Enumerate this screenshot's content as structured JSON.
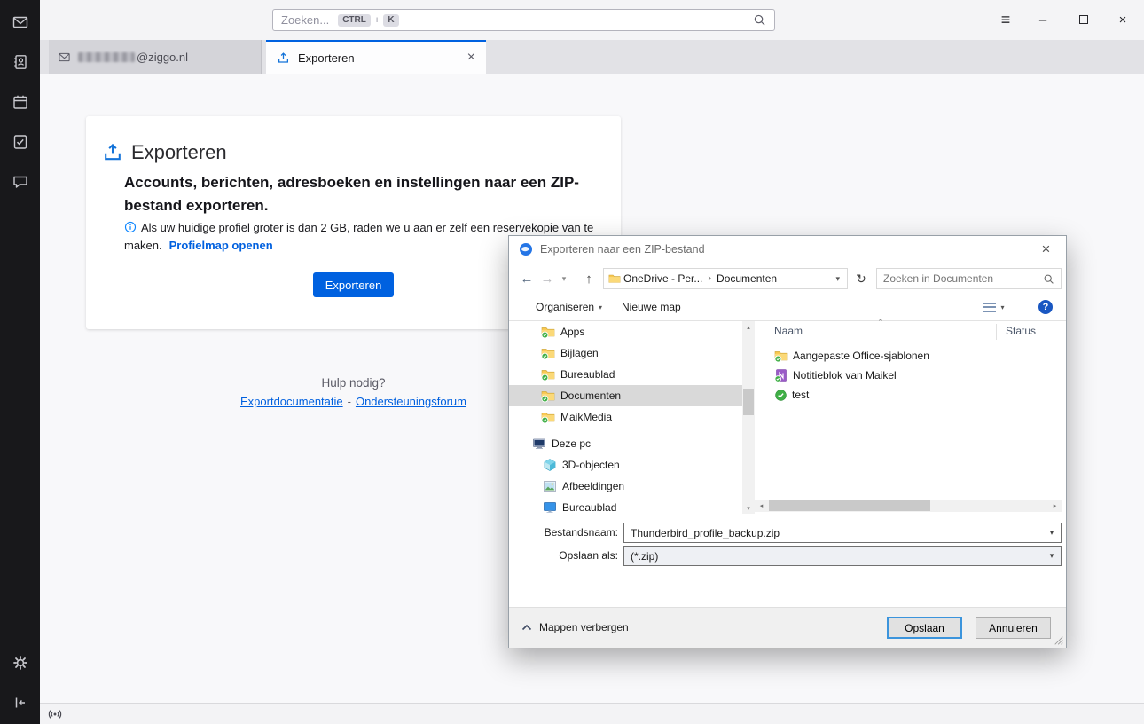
{
  "colors": {
    "accent_blue": "#0061e0",
    "link_blue": "#0060df",
    "selection_gray": "#d9d9d9",
    "sync_green": "#3faf46",
    "default_button_border": "#0078d7"
  },
  "topbar": {
    "search_placeholder": "Zoeken...",
    "shortcut_ctrl": "CTRL",
    "shortcut_plus": "+",
    "shortcut_k": "K"
  },
  "tabs": {
    "account_suffix": "@ziggo.nl",
    "export_label": "Exporteren"
  },
  "export_page": {
    "title": "Exporteren",
    "subtitle": "Accounts, berichten, adresboeken en instellingen naar een ZIP-bestand exporteren.",
    "info_text": "Als uw huidige profiel groter is dan 2 GB, raden we u aan er zelf een reservekopie van te maken.",
    "profile_link": "Profielmap openen",
    "export_button": "Exporteren",
    "help_heading": "Hulp nodig?",
    "help_link_docs": "Exportdocumentatie",
    "help_separator": "-",
    "help_link_forum": "Ondersteuningsforum"
  },
  "dialog": {
    "title": "Exporteren naar een ZIP-bestand",
    "breadcrumb_root": "OneDrive - Per...",
    "breadcrumb_current": "Documenten",
    "search_placeholder": "Zoeken in Documenten",
    "organize_button": "Organiseren",
    "new_folder_button": "Nieuwe map",
    "tree": [
      {
        "label": "Apps"
      },
      {
        "label": "Bijlagen"
      },
      {
        "label": "Bureaublad"
      },
      {
        "label": "Documenten"
      },
      {
        "label": "MaikMedia"
      },
      {
        "label": "Deze pc"
      },
      {
        "label": "3D-objecten"
      },
      {
        "label": "Afbeeldingen"
      },
      {
        "label": "Bureaublad"
      }
    ],
    "columns": {
      "name": "Naam",
      "status": "Status"
    },
    "files": [
      {
        "name": "Aangepaste Office-sjablonen"
      },
      {
        "name": "Notitieblok van Maikel"
      },
      {
        "name": "test"
      }
    ],
    "filename_label": "Bestandsnaam:",
    "filename_value": "Thunderbird_profile_backup.zip",
    "saveas_label": "Opslaan als:",
    "saveas_value": "(*.zip)",
    "hide_folders": "Mappen verbergen",
    "save_button": "Opslaan",
    "cancel_button": "Annuleren"
  },
  "icons": {
    "back": "←",
    "forward": "→",
    "up": "↑",
    "refresh": "↻",
    "menu": "≡",
    "minimize": "–",
    "close": "×",
    "caret_down": "▾",
    "breadcrumb_sep": "›",
    "sort_asc": "ˆ",
    "scroll_up": "▴",
    "scroll_down": "▾",
    "scroll_left": "◂",
    "scroll_right": "▸",
    "help": "?"
  }
}
